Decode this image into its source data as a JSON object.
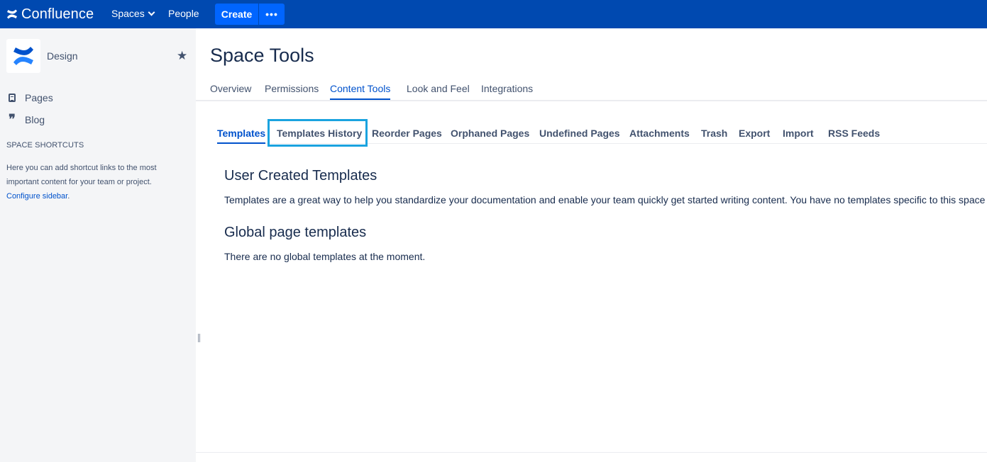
{
  "topbar": {
    "logo_text": "Confluence",
    "spaces_label": "Spaces",
    "people_label": "People",
    "create_label": "Create",
    "more_label": "•••",
    "brand_color": "#0049b0",
    "accent_color": "#0065ff"
  },
  "sidebar": {
    "space_name": "Design",
    "items": [
      {
        "label": "Pages",
        "icon": "page-icon"
      },
      {
        "label": "Blog",
        "icon": "quote-icon"
      }
    ],
    "shortcuts_heading": "SPACE SHORTCUTS",
    "shortcuts_text": "Here you can add shortcut links to the most important content for your team or project.",
    "configure_link": "Configure sidebar"
  },
  "main": {
    "title": "Space Tools",
    "tabs": [
      {
        "label": "Overview",
        "active": false
      },
      {
        "label": "Permissions",
        "active": false
      },
      {
        "label": "Content Tools",
        "active": true
      },
      {
        "label": "Look and Feel",
        "active": false
      },
      {
        "label": "Integrations",
        "active": false
      }
    ],
    "subtabs": [
      {
        "label": "Templates",
        "active": true
      },
      {
        "label": "Templates History",
        "active": false
      },
      {
        "label": "Reorder Pages",
        "active": false
      },
      {
        "label": "Orphaned Pages",
        "active": false
      },
      {
        "label": "Undefined Pages",
        "active": false
      },
      {
        "label": "Attachments",
        "active": false
      },
      {
        "label": "Trash",
        "active": false
      },
      {
        "label": "Export",
        "active": false
      },
      {
        "label": "Import",
        "active": false
      },
      {
        "label": "RSS Feeds",
        "active": false
      }
    ],
    "user_templates_heading": "User Created Templates",
    "user_templates_text": "Templates are a great way to help you standardize your documentation and enable your team quickly get started writing content. You have no templates specific to this space",
    "global_templates_heading": "Global page templates",
    "global_templates_text": "There are no global templates at the moment."
  }
}
